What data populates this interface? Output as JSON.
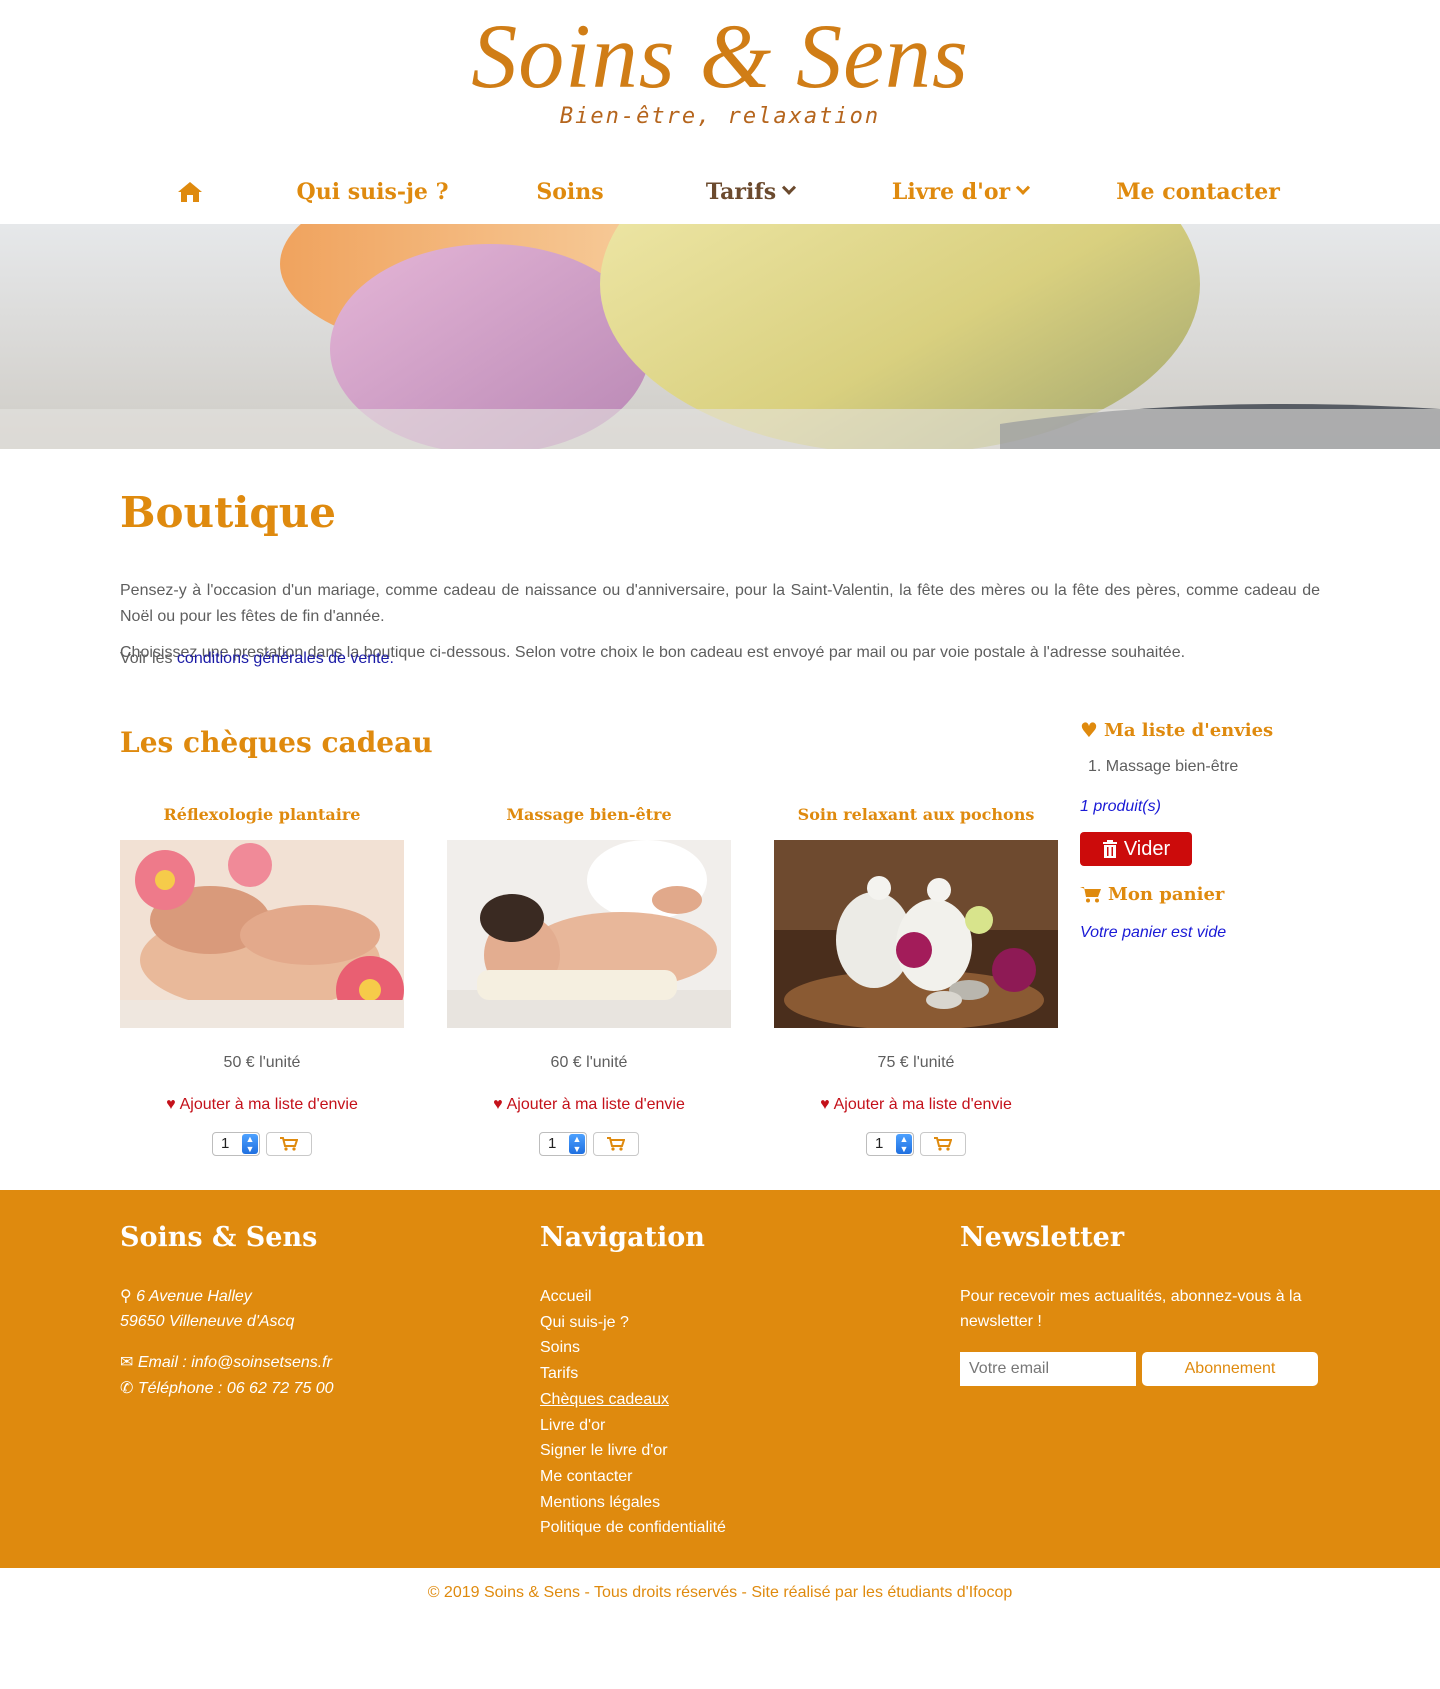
{
  "logo": {
    "title": "Soins & Sens",
    "subtitle": "Bien-être, relaxation"
  },
  "nav": {
    "home_icon": "home-icon",
    "items": [
      {
        "label": "Qui suis-je ?"
      },
      {
        "label": "Soins"
      },
      {
        "label": "Tarifs"
      },
      {
        "label": "Livre d'or"
      },
      {
        "label": "Me contacter"
      }
    ]
  },
  "main": {
    "title": "Boutique",
    "intro": "Pensez-y à l'occasion d'un mariage, comme cadeau de naissance ou d'anniversaire, pour la Saint-Valentin, la fête des mères ou la fête des pères, comme cadeau de Noël ou pour les fêtes de fin d'année.",
    "intro2": "Choisissez une prestation dans la boutique ci-dessous. Selon votre choix le bon cadeau est envoyé par mail ou par voie postale à l'adresse souhaitée.",
    "cgv_prefix": "Voir les ",
    "cgv_link": "conditions générales de vente.",
    "section_title": "Les chèques cadeau"
  },
  "products": [
    {
      "name": "Réflexologie plantaire",
      "price": "50 € l'unité",
      "wish": "Ajouter à ma liste d'envie",
      "qty": "1"
    },
    {
      "name": "Massage bien-être",
      "price": "60 € l'unité",
      "wish": "Ajouter à ma liste d'envie",
      "qty": "1"
    },
    {
      "name": "Soin relaxant aux pochons",
      "price": "75 € l'unité",
      "wish": "Ajouter à ma liste d'envie",
      "qty": "1"
    }
  ],
  "sidebar": {
    "wishlist_title": "Ma liste d'envies",
    "wishlist_items": [
      "1. Massage bien-être"
    ],
    "count": "1 produit(s)",
    "clear_label": "Vider",
    "cart_title": "Mon panier",
    "cart_empty": "Votre panier est vide"
  },
  "footer": {
    "col1": {
      "title": "Soins & Sens",
      "address1": "6 Avenue Halley",
      "address2": "59650 Villeneuve d'Ascq",
      "email": "Email : info@soinsetsens.fr",
      "phone": "Téléphone : 06 62 72 75 00"
    },
    "col2": {
      "title": "Navigation",
      "links": [
        "Accueil",
        "Qui suis-je ?",
        "Soins",
        "Tarifs",
        "Chèques cadeaux",
        "Livre d'or",
        "Signer le livre d'or",
        "Me contacter",
        "Mentions légales",
        "Politique de confidentialité"
      ]
    },
    "col3": {
      "title": "Newsletter",
      "text": "Pour recevoir mes actualités, abonnez-vous à la newsletter !",
      "placeholder": "Votre email",
      "button": "Abonnement"
    },
    "copyright": "© 2019 Soins & Sens - Tous droits réservés - Site réalisé par les étudiants d'Ifocop"
  },
  "colors": {
    "brand": "#df8a0e",
    "danger": "#cc0b0b",
    "link": "#1a1ad6"
  }
}
